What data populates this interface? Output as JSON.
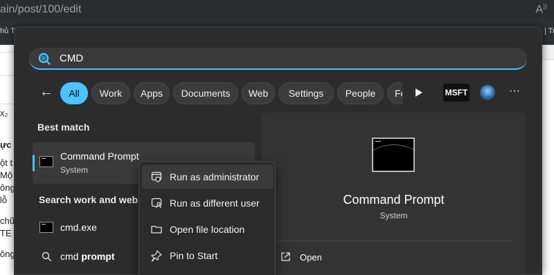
{
  "browser": {
    "address_fragment": "ain/post/100/edit",
    "bookmark_left_fragment": "hủ T",
    "bookmark_right_fragment": "| Tr",
    "doc_fragments": [
      "x₂",
      "ực l",
      "ột t",
      "Mộ",
      "ông",
      "lỗ",
      "chữ",
      "TE",
      "ông"
    ]
  },
  "search": {
    "value": "CMD"
  },
  "filters": [
    {
      "label": "All",
      "active": true
    },
    {
      "label": "Work",
      "active": false
    },
    {
      "label": "Apps",
      "active": false
    },
    {
      "label": "Documents",
      "active": false
    },
    {
      "label": "Web",
      "active": false
    },
    {
      "label": "Settings",
      "active": false
    },
    {
      "label": "People",
      "active": false
    },
    {
      "label": "Fol",
      "active": false
    }
  ],
  "toolbar": {
    "msft_label": "MSFT",
    "more_label": "···"
  },
  "best_match": {
    "heading": "Best match",
    "title": "Command Prompt",
    "subtitle": "System"
  },
  "search_web": {
    "heading": "Search work and web",
    "results": [
      {
        "label": "cmd.exe",
        "icon": "cmd-icon"
      },
      {
        "label_prefix": "cmd ",
        "label_bold": "prompt",
        "icon": "search-icon"
      }
    ]
  },
  "preview": {
    "title": "Command Prompt",
    "subtitle": "System",
    "open_label": "Open"
  },
  "context_menu": {
    "items": [
      {
        "label": "Run as administrator",
        "icon": "shield-icon",
        "hovered": true
      },
      {
        "label": "Run as different user",
        "icon": "user-icon",
        "hovered": false
      },
      {
        "label": "Open file location",
        "icon": "folder-icon",
        "hovered": false
      },
      {
        "label": "Pin to Start",
        "icon": "pin-icon",
        "hovered": false
      }
    ]
  },
  "colors": {
    "accent": "#4cc2ff",
    "panel": "#2c2c2c",
    "hover": "#3a3a3a"
  }
}
